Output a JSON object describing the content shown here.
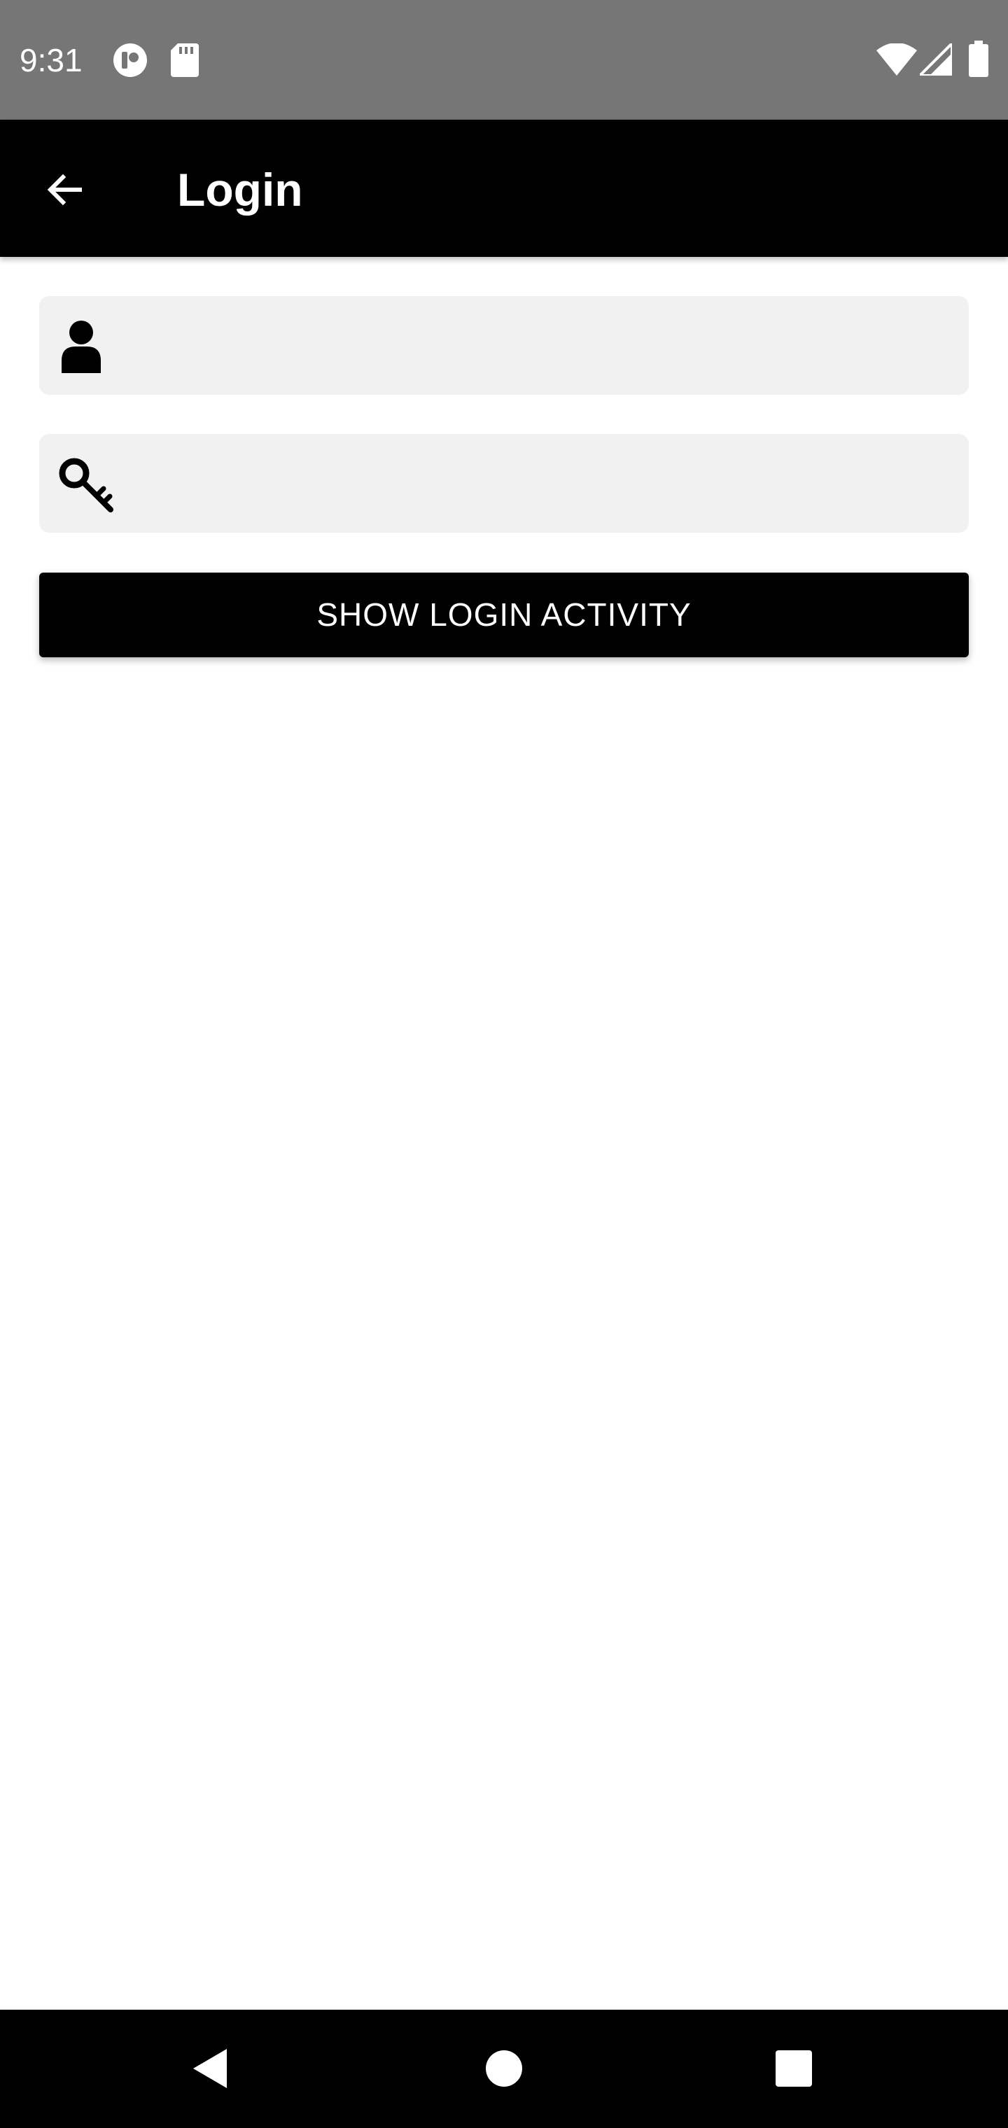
{
  "status_bar": {
    "time": "9:31",
    "icons": [
      "app-notification-icon",
      "sd-card-icon",
      "wifi-icon",
      "signal-icon",
      "battery-icon"
    ],
    "background": "#767676"
  },
  "app_bar": {
    "title": "Login",
    "back_icon": "arrow-back-icon",
    "background": "#000000"
  },
  "form": {
    "username": {
      "icon": "person-icon",
      "value": "",
      "placeholder": ""
    },
    "password": {
      "icon": "key-icon",
      "value": "",
      "placeholder": ""
    },
    "field_background": "#f1f1f1"
  },
  "actions": {
    "show_login_activity_label": "SHOW LOGIN ACTIVITY"
  },
  "nav_bar": {
    "buttons": [
      "back-triangle-icon",
      "home-circle-icon",
      "recents-square-icon"
    ]
  }
}
